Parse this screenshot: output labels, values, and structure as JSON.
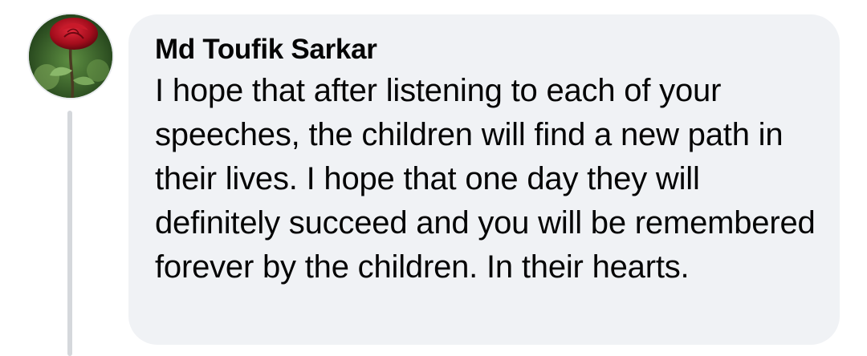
{
  "comment": {
    "author": "Md Toufik Sarkar",
    "text": "I hope that after listening to each of your speeches, the children will find a new path in their lives. I hope that one day they will definitely succeed and you will be remembered forever by the children. In their hearts.",
    "avatar_icon": "rose-icon"
  },
  "colors": {
    "bubble_background": "#f0f2f5",
    "text": "#050505",
    "thread_line": "#d5d8dc"
  }
}
